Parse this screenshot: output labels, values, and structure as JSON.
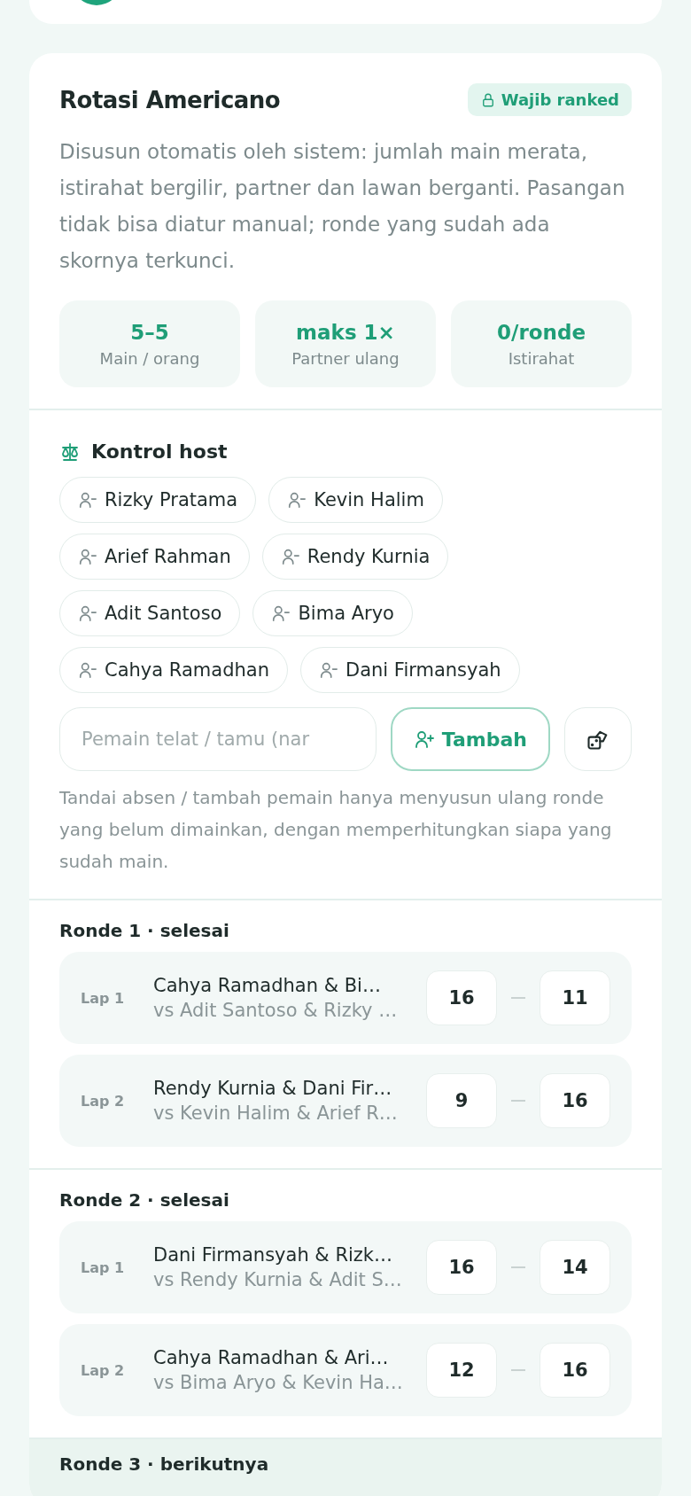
{
  "rotation": {
    "title": "Rotasi Americano",
    "badge": "Wajib ranked",
    "description": "Disusun otomatis oleh sistem: jumlah main merata, istirahat bergilir, partner dan lawan berganti. Pasangan tidak bisa diatur manual; ronde yang sudah ada skornya terkunci.",
    "stats": [
      {
        "value": "5–5",
        "label": "Main / orang"
      },
      {
        "value": "maks 1×",
        "label": "Partner ulang"
      },
      {
        "value": "0/ronde",
        "label": "Istirahat"
      }
    ]
  },
  "host_control": {
    "title": "Kontrol host",
    "players": [
      "Rizky Pratama",
      "Kevin Halim",
      "Arief Rahman",
      "Rendy Kurnia",
      "Adit Santoso",
      "Bima Aryo",
      "Cahya Ramadhan",
      "Dani Firmansyah"
    ],
    "input": {
      "placeholder": "Pemain telat / tamu (nar"
    },
    "add_button": "Tambah",
    "hint": "Tandai absen / tambah pemain hanya menyusun ulang ronde yang belum dimainkan, dengan memperhitungkan siapa yang sudah main."
  },
  "rounds": [
    {
      "title": "Ronde 1 · selesai",
      "upcoming": false,
      "matches": [
        {
          "lap": "Lap 1",
          "team": "Cahya Ramadhan & Bi…",
          "opponents": "vs Adit Santoso & Rizky …",
          "score_a": "16",
          "score_b": "11"
        },
        {
          "lap": "Lap 2",
          "team": "Rendy Kurnia & Dani Fir…",
          "opponents": "vs Kevin Halim & Arief R…",
          "score_a": "9",
          "score_b": "16"
        }
      ]
    },
    {
      "title": "Ronde 2 · selesai",
      "upcoming": false,
      "matches": [
        {
          "lap": "Lap 1",
          "team": "Dani Firmansyah & Rizk…",
          "opponents": "vs Rendy Kurnia & Adit S…",
          "score_a": "16",
          "score_b": "14"
        },
        {
          "lap": "Lap 2",
          "team": "Cahya Ramadhan & Ari…",
          "opponents": "vs Bima Aryo & Kevin Ha…",
          "score_a": "12",
          "score_b": "16"
        }
      ]
    },
    {
      "title": "Ronde 3 · berikutnya",
      "upcoming": true
    }
  ]
}
